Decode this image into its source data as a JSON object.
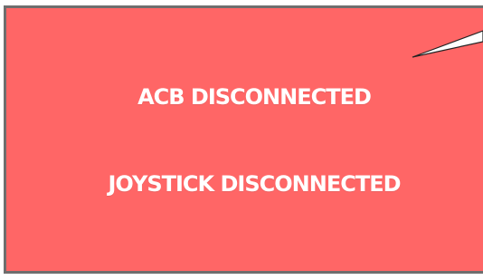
{
  "status_panel": {
    "acb_message": "ACB DISCONNECTED",
    "joystick_message": "JOYSTICK DISCONNECTED"
  },
  "colors": {
    "panel_background": "#ff6666",
    "panel_border": "#6e6e6e",
    "message_text": "#ffffff"
  },
  "icons": {
    "pointer": "callout-pointer-icon"
  }
}
